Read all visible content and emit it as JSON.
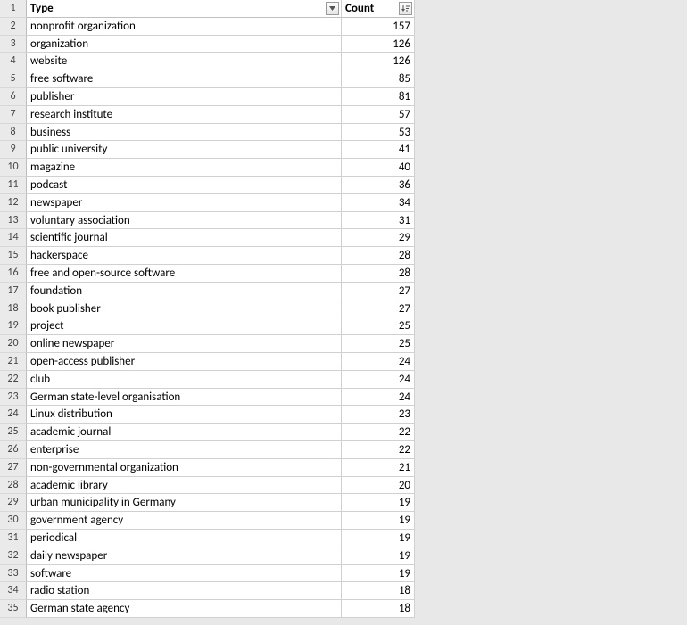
{
  "headers": {
    "type": "Type",
    "count": "Count"
  },
  "rows": [
    {
      "n": 1,
      "type_header": true
    },
    {
      "n": 2,
      "type": "nonprofit organization",
      "count": 157
    },
    {
      "n": 3,
      "type": "organization",
      "count": 126
    },
    {
      "n": 4,
      "type": "website",
      "count": 126
    },
    {
      "n": 5,
      "type": "free software",
      "count": 85
    },
    {
      "n": 6,
      "type": "publisher",
      "count": 81
    },
    {
      "n": 7,
      "type": "research institute",
      "count": 57
    },
    {
      "n": 8,
      "type": "business",
      "count": 53
    },
    {
      "n": 9,
      "type": "public university",
      "count": 41
    },
    {
      "n": 10,
      "type": "magazine",
      "count": 40
    },
    {
      "n": 11,
      "type": "podcast",
      "count": 36
    },
    {
      "n": 12,
      "type": "newspaper",
      "count": 34
    },
    {
      "n": 13,
      "type": "voluntary association",
      "count": 31
    },
    {
      "n": 14,
      "type": "scientific journal",
      "count": 29
    },
    {
      "n": 15,
      "type": "hackerspace",
      "count": 28
    },
    {
      "n": 16,
      "type": "free and open-source software",
      "count": 28
    },
    {
      "n": 17,
      "type": "foundation",
      "count": 27
    },
    {
      "n": 18,
      "type": "book publisher",
      "count": 27
    },
    {
      "n": 19,
      "type": "project",
      "count": 25
    },
    {
      "n": 20,
      "type": "online newspaper",
      "count": 25
    },
    {
      "n": 21,
      "type": "open-access publisher",
      "count": 24
    },
    {
      "n": 22,
      "type": "club",
      "count": 24
    },
    {
      "n": 23,
      "type": "German state-level organisation",
      "count": 24
    },
    {
      "n": 24,
      "type": "Linux distribution",
      "count": 23
    },
    {
      "n": 25,
      "type": "academic journal",
      "count": 22
    },
    {
      "n": 26,
      "type": "enterprise",
      "count": 22
    },
    {
      "n": 27,
      "type": "non-governmental organization",
      "count": 21
    },
    {
      "n": 28,
      "type": "academic library",
      "count": 20
    },
    {
      "n": 29,
      "type": "urban municipality in Germany",
      "count": 19
    },
    {
      "n": 30,
      "type": "government agency",
      "count": 19
    },
    {
      "n": 31,
      "type": "periodical",
      "count": 19
    },
    {
      "n": 32,
      "type": "daily newspaper",
      "count": 19
    },
    {
      "n": 33,
      "type": "software",
      "count": 19
    },
    {
      "n": 34,
      "type": "radio station",
      "count": 18
    },
    {
      "n": 35,
      "type": "German state agency",
      "count": 18
    }
  ]
}
